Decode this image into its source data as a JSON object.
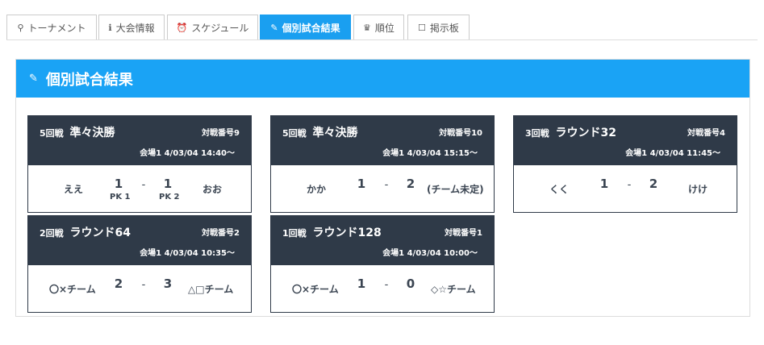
{
  "tabs": [
    {
      "label": "トーナメント",
      "icon": "bracket-icon",
      "glyph": "⚲"
    },
    {
      "label": "大会情報",
      "icon": "info-icon",
      "glyph": "ℹ"
    },
    {
      "label": "スケジュール",
      "icon": "clock-icon",
      "glyph": "⏰"
    },
    {
      "label": "個別試合結果",
      "icon": "pencil-icon",
      "glyph": "✎",
      "active": true
    },
    {
      "label": "順位",
      "icon": "trophy-icon",
      "glyph": "♛"
    },
    {
      "label": "掲示板",
      "icon": "comment-icon",
      "glyph": "☐"
    }
  ],
  "colors": {
    "accent": "#1aa3f5",
    "card_header": "#2f3a48",
    "border": "#dddddd"
  },
  "panel": {
    "title": "個別試合結果",
    "icon": "pencil-icon",
    "glyph": "✎"
  },
  "matches": [
    {
      "round_no": "5回戦",
      "round_name": "準々決勝",
      "match_no": "対戦番号9",
      "venue": "会場1  4/03/04  14:40〜",
      "home": "ええ",
      "home_score": "1",
      "sep": "-",
      "away_score": "1",
      "away": "おお",
      "home_pk": "PK 1",
      "away_pk": "PK 2"
    },
    {
      "round_no": "5回戦",
      "round_name": "準々決勝",
      "match_no": "対戦番号10",
      "venue": "会場1  4/03/04  15:15〜",
      "home": "かか",
      "home_score": "1",
      "sep": "-",
      "away_score": "2",
      "away": "(チーム未定)"
    },
    {
      "round_no": "3回戦",
      "round_name": "ラウンド32",
      "match_no": "対戦番号4",
      "venue": "会場1  4/03/04  11:45〜",
      "home": "くく",
      "home_score": "1",
      "sep": "-",
      "away_score": "2",
      "away": "けけ"
    },
    {
      "round_no": "2回戦",
      "round_name": "ラウンド64",
      "match_no": "対戦番号2",
      "venue": "会場1  4/03/04  10:35〜",
      "home": "〇×チーム",
      "home_score": "2",
      "sep": "-",
      "away_score": "3",
      "away": "△□チーム"
    },
    {
      "round_no": "1回戦",
      "round_name": "ラウンド128",
      "match_no": "対戦番号1",
      "venue": "会場1  4/03/04  10:00〜",
      "home": "〇×チーム",
      "home_score": "1",
      "sep": "-",
      "away_score": "0",
      "away": "◇☆チーム"
    }
  ]
}
